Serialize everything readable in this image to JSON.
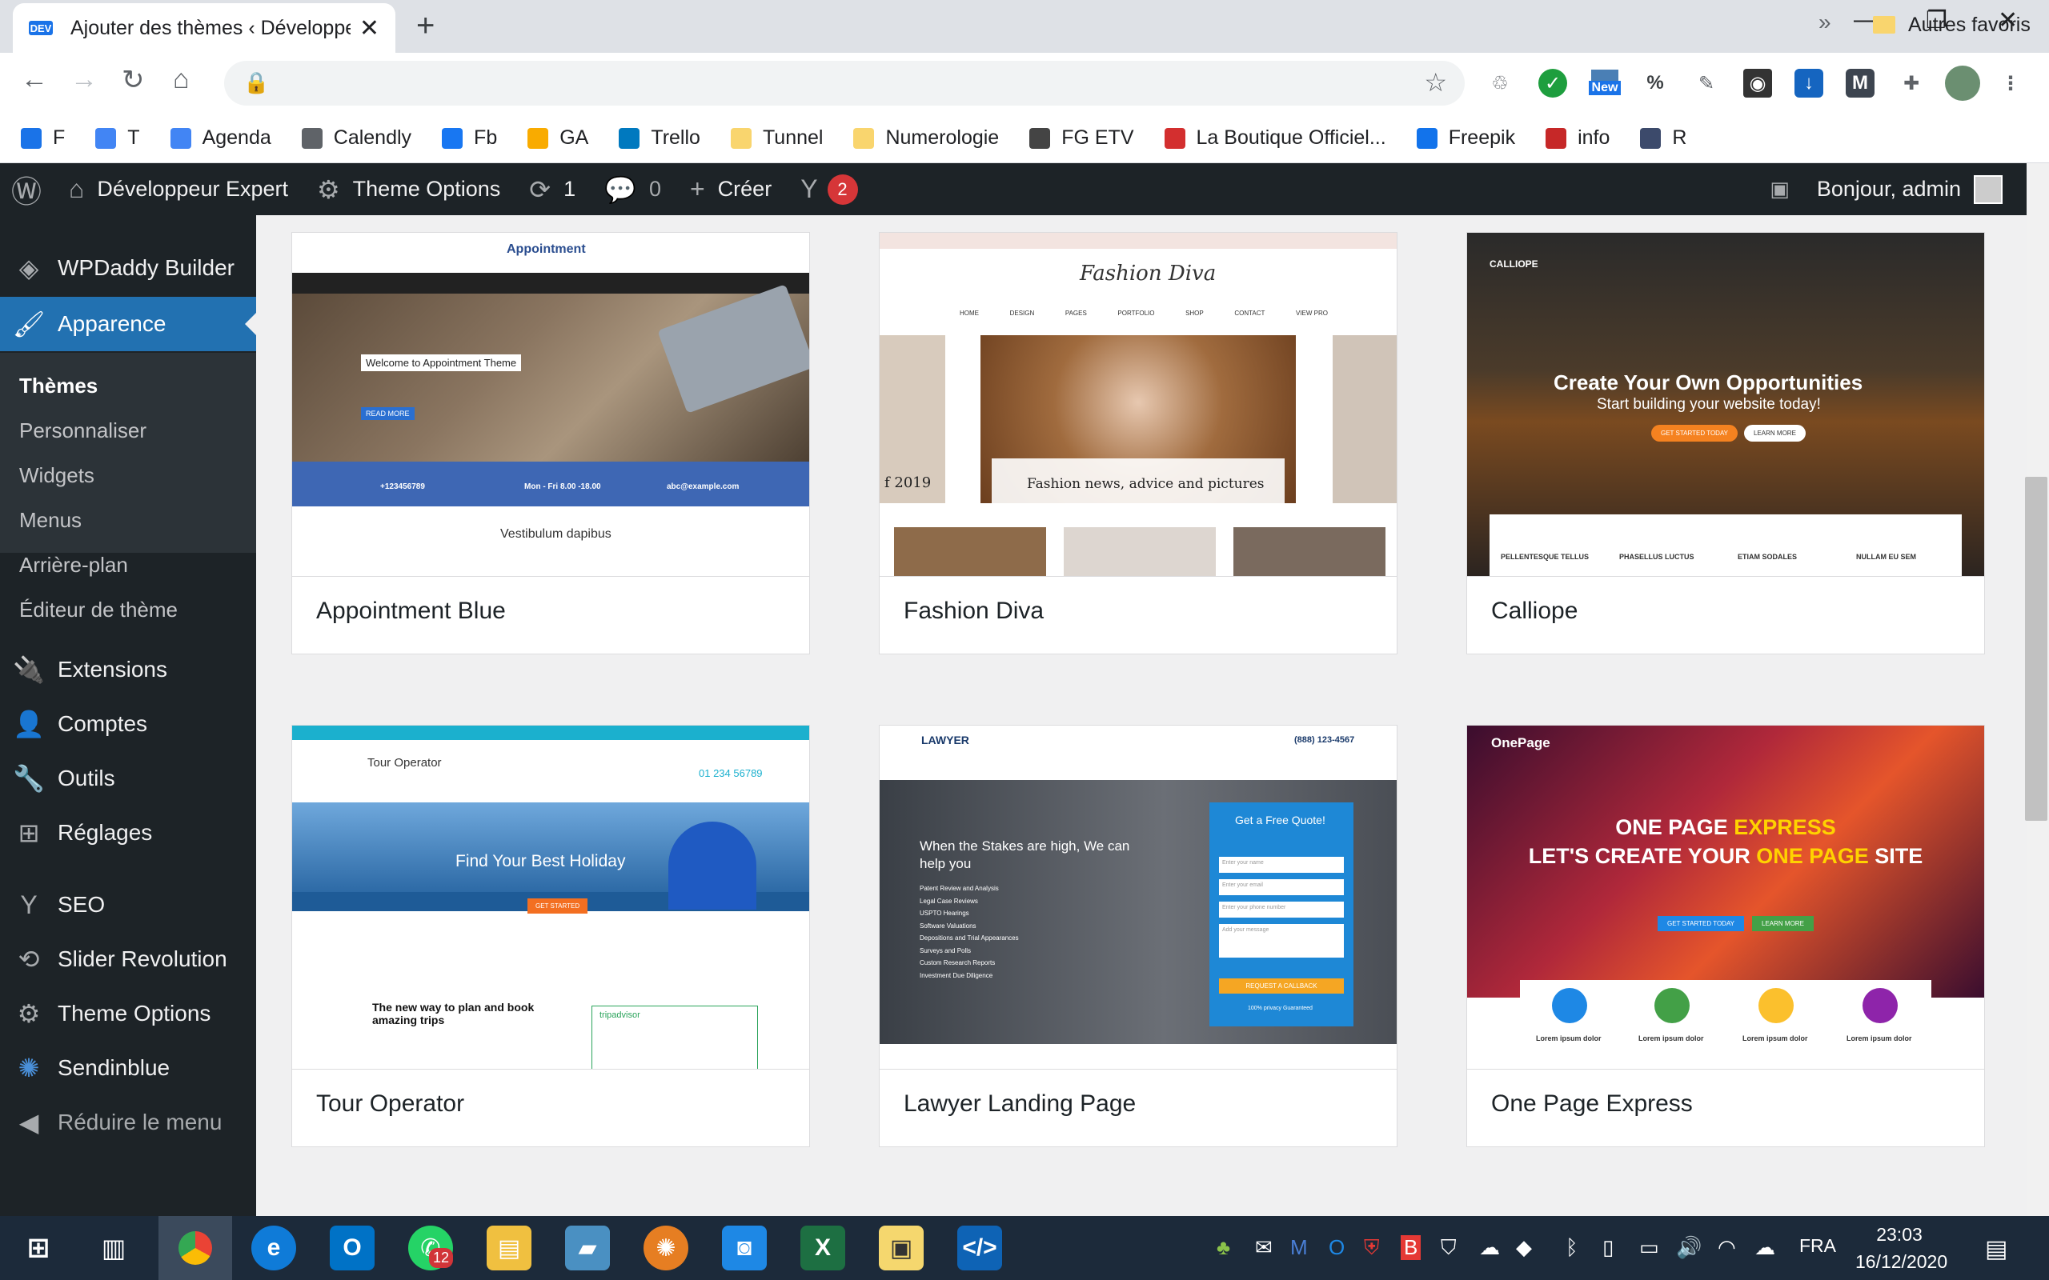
{
  "browser": {
    "tab_badge": "DEV",
    "tab_title": "Ajouter des thèmes ‹ Développeur",
    "new_badge": "New",
    "percent": "%"
  },
  "bookmarks": [
    {
      "label": "F",
      "color": "#1a73e8"
    },
    {
      "label": "T",
      "color": "#4285f4"
    },
    {
      "label": "Agenda",
      "color": "#4285f4"
    },
    {
      "label": "Calendly",
      "color": "#5f6368"
    },
    {
      "label": "Fb",
      "color": "#1877f2"
    },
    {
      "label": "GA",
      "color": "#f9ab00"
    },
    {
      "label": "Trello",
      "color": "#0079bf"
    },
    {
      "label": "Tunnel",
      "color": "#f9d56e"
    },
    {
      "label": "Numerologie",
      "color": "#f9d56e"
    },
    {
      "label": "FG ETV",
      "color": "#444"
    },
    {
      "label": "La Boutique Officiel...",
      "color": "#d32f2f"
    },
    {
      "label": "Freepik",
      "color": "#1273eb"
    },
    {
      "label": "info",
      "color": "#c62828"
    },
    {
      "label": "R",
      "color": "#3c4a6b"
    }
  ],
  "bookmarks_more": "»",
  "bookmarks_others": "Autres favoris",
  "adminbar": {
    "site": "Développeur Expert",
    "theme_options": "Theme Options",
    "updates": "1",
    "comments": "0",
    "create": "Créer",
    "seo_count": "2",
    "greeting": "Bonjour, admin"
  },
  "sidebar": {
    "wpdaddy": "WPDaddy Builder",
    "appearance": "Apparence",
    "sub": [
      "Thèmes",
      "Personnaliser",
      "Widgets",
      "Menus",
      "Arrière-plan",
      "Éditeur de thème"
    ],
    "items": [
      "Extensions",
      "Comptes",
      "Outils",
      "Réglages",
      "SEO",
      "Slider Revolution",
      "Theme Options",
      "Sendinblue"
    ],
    "collapse": "Réduire le menu"
  },
  "themes": [
    {
      "name": "Appointment Blue"
    },
    {
      "name": "Fashion Diva"
    },
    {
      "name": "Calliope"
    },
    {
      "name": "Tour Operator"
    },
    {
      "name": "Lawyer Landing Page"
    },
    {
      "name": "One Page Express"
    }
  ],
  "previews": {
    "appointment": {
      "logo": "Appointment",
      "welcome": "Welcome to Appointment Theme",
      "vestibulum": "Vestibulum dapibus",
      "phone": "+123456789",
      "hours": "Mon - Fri 8.00 -18.00",
      "email": "abc@example.com",
      "read_more": "READ MORE"
    },
    "fashion": {
      "logo": "Fashion Diva",
      "year": "f 2019",
      "caption": "Fashion news, advice and pictures",
      "nav": [
        "HOME",
        "DESIGN",
        "PAGES",
        "PORTFOLIO",
        "SHOP",
        "CONTACT",
        "VIEW PRO"
      ]
    },
    "calliope": {
      "brand": "CALLIOPE",
      "headline": "Create Your Own Opportunities",
      "sub": "Start building your website today!",
      "cta1": "GET STARTED TODAY",
      "cta2": "LEARN MORE",
      "features": [
        "PELLENTESQUE TELLUS",
        "PHASELLUS LUCTUS",
        "ETIAM SODALES",
        "NULLAM EU SEM"
      ]
    },
    "tour": {
      "logo": "Tour Operator",
      "phone": "01 234 56789",
      "hero": "Find Your Best Holiday",
      "lead": "The new way to plan and book amazing trips",
      "cta": "GET STARTED",
      "trip": "tripadvisor"
    },
    "lawyer": {
      "logo": "LAWYER",
      "phone": "(888) 123-4567",
      "hero": "When the Stakes are high, We can help you",
      "quote": "Get a Free Quote!",
      "list": [
        "Patent Review and Analysis",
        "Legal Case Reviews",
        "USPTO Hearings",
        "Software Valuations",
        "Depositions and Trial Appearances",
        "Surveys and Polls",
        "Custom Research Reports",
        "Investment Due Diligence"
      ],
      "fields": [
        "Enter your name",
        "Enter your email",
        "Enter your phone number",
        "Add your message"
      ],
      "callback": "REQUEST A CALLBACK",
      "privacy": "100% privacy Guaranteed"
    },
    "onepage": {
      "logo": "OnePage",
      "line1a": "ONE PAGE ",
      "line1b": "EXPRESS",
      "line2a": "LET'S CREATE YOUR ",
      "line2b": "ONE PAGE",
      "line2c": " SITE",
      "cta1": "GET STARTED TODAY",
      "cta2": "LEARN MORE",
      "feature": "Lorem ipsum dolor"
    }
  },
  "taskbar": {
    "outlook_badge": "12",
    "lang": "FRA",
    "time": "23:03",
    "date": "16/12/2020"
  }
}
